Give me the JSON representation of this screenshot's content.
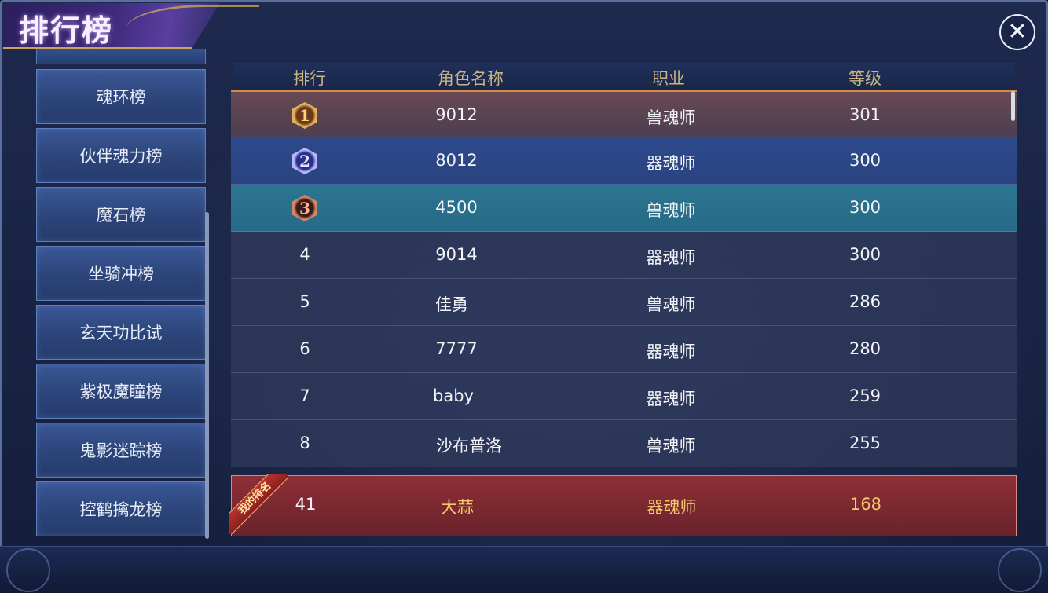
{
  "title": "排行榜",
  "close_symbol": "✕",
  "sidebar": {
    "items": [
      {
        "label": "魂环榜"
      },
      {
        "label": "伙伴魂力榜"
      },
      {
        "label": "魔石榜"
      },
      {
        "label": "坐骑冲榜"
      },
      {
        "label": "玄天功比试"
      },
      {
        "label": "紫极魔瞳榜"
      },
      {
        "label": "鬼影迷踪榜"
      },
      {
        "label": "控鹤擒龙榜"
      }
    ]
  },
  "table": {
    "headers": {
      "rank": "排行",
      "name": "角色名称",
      "class": "职业",
      "level": "等级"
    },
    "rows": [
      {
        "rank": "1",
        "name": "9012",
        "class": "兽魂师",
        "level": "301"
      },
      {
        "rank": "2",
        "name": "8012",
        "class": "器魂师",
        "level": "300"
      },
      {
        "rank": "3",
        "name": "4500",
        "class": "兽魂师",
        "level": "300"
      },
      {
        "rank": "4",
        "name": "9014",
        "class": "器魂师",
        "level": "300"
      },
      {
        "rank": "5",
        "name": "佳勇",
        "class": "兽魂师",
        "level": "286"
      },
      {
        "rank": "6",
        "name": "7777",
        "class": "器魂师",
        "level": "280"
      },
      {
        "rank": "7",
        "name": "baby",
        "class": "器魂师",
        "level": "259"
      },
      {
        "rank": "8",
        "name": "沙布普洛",
        "class": "兽魂师",
        "level": "255"
      }
    ]
  },
  "my_rank": {
    "ribbon": "我的排名",
    "rank": "41",
    "name": "大蒜",
    "class": "器魂师",
    "level": "168"
  },
  "colors": {
    "header_text": "#c8b487",
    "my_rank_name": "#f5c96b",
    "my_rank_class": "#f5c96b",
    "my_rank_level": "#f5c96b"
  }
}
